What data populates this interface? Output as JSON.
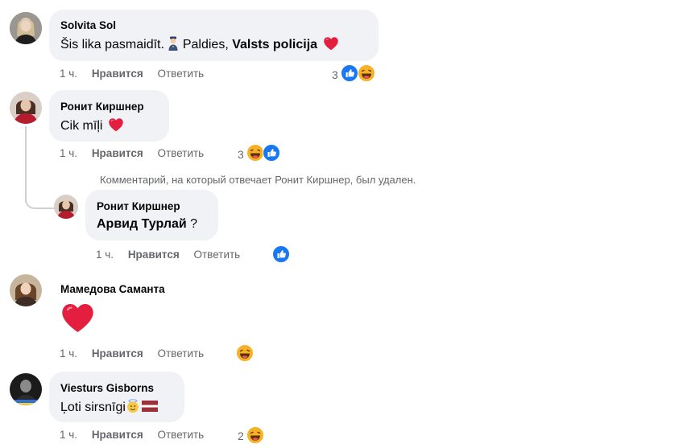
{
  "comments": [
    {
      "author": "Solvita Sol",
      "text_before": "Šis lika pasmaidīt. ",
      "text_mid": " Paldies, ",
      "text_bold": "Valsts policija",
      "time": "1 ч.",
      "like": "Нравится",
      "reply": "Ответить",
      "reaction_count": "3"
    },
    {
      "author": "Ронит Киршнер",
      "text": "Cik mīļi",
      "time": "1 ч.",
      "like": "Нравится",
      "reply": "Ответить",
      "reaction_count": "3"
    },
    {
      "deleted_notice": "Комментарий, на который отвечает Ронит Киршнер, был удален."
    },
    {
      "author": "Ронит Киршнер",
      "text_bold": "Арвид Турлай",
      "text_after": " ?",
      "time": "1 ч.",
      "like": "Нравится",
      "reply": "Ответить"
    },
    {
      "author": "Мамедова Саманта",
      "time": "1 ч.",
      "like": "Нравится",
      "reply": "Ответить"
    },
    {
      "author": "Viesturs Gisborns",
      "text": "Ļoti sirsnīgi",
      "time": "1 ч.",
      "like": "Нравится",
      "reply": "Ответить",
      "reaction_count": "2"
    }
  ],
  "colors": {
    "like_blue": "#1877f2",
    "heart_red": "#e41e3f",
    "haha_yellow": "#f7b125",
    "bubble_bg": "#f0f2f5",
    "meta_gray": "#65676b"
  }
}
